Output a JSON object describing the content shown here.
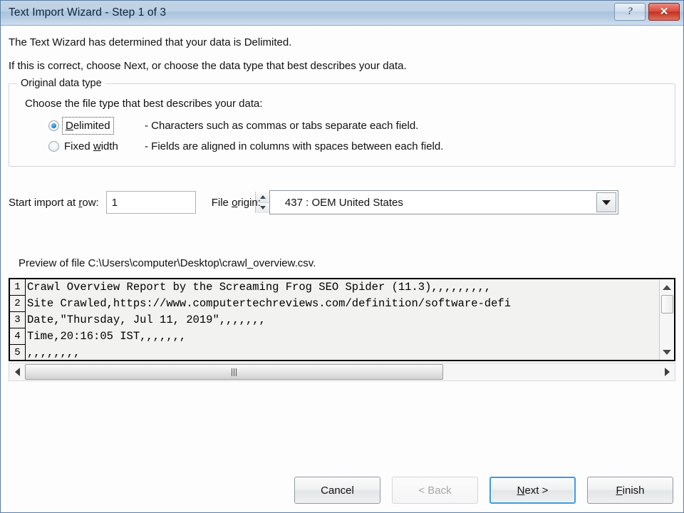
{
  "window": {
    "title": "Text Import Wizard - Step 1 of 3",
    "help_button": "?",
    "close_button": "✕"
  },
  "intro": {
    "line1": "The Text Wizard has determined that your data is Delimited.",
    "line2": "If this is correct, choose Next, or choose the data type that best describes your data."
  },
  "original_data_type": {
    "group_title": "Original data type",
    "lead": "Choose the file type that best describes your data:",
    "options": [
      {
        "label_prefix": "",
        "label_accel": "D",
        "label_suffix": "elimited",
        "description": "- Characters such as commas or tabs separate each field.",
        "selected": true,
        "focused": true
      },
      {
        "label_prefix": "Fixed ",
        "label_accel": "w",
        "label_suffix": "idth",
        "description": "- Fields are aligned in columns with spaces between each field.",
        "selected": false,
        "focused": false
      }
    ]
  },
  "options_row": {
    "start_row_label_prefix": "Start import at ",
    "start_row_label_accel": "r",
    "start_row_label_suffix": "ow:",
    "start_row_value": "1",
    "file_origin_label_prefix": "File ",
    "file_origin_label_accel": "o",
    "file_origin_label_suffix": "rigin:",
    "file_origin_value": "437 : OEM United States"
  },
  "preview": {
    "label": "Preview of file C:\\Users\\computer\\Desktop\\crawl_overview.csv.",
    "rows": [
      {
        "number": "1",
        "text": "Crawl Overview Report by the Screaming Frog SEO Spider (11.3),,,,,,,,,"
      },
      {
        "number": "2",
        "text": "Site Crawled,https://www.computertechreviews.com/definition/software-defi"
      },
      {
        "number": "3",
        "text": "Date,\"Thursday, Jul 11, 2019\",,,,,,,"
      },
      {
        "number": "4",
        "text": "Time,20:16:05 IST,,,,,,,"
      },
      {
        "number": "5",
        "text": ",,,,,,,,"
      }
    ]
  },
  "footer": {
    "cancel": "Cancel",
    "back": "< Back",
    "next_prefix": "",
    "next_accel": "N",
    "next_suffix": "ext >",
    "finish_prefix": "",
    "finish_accel": "F",
    "finish_suffix": "inish"
  },
  "colors": {
    "titlebar_accent": "#b6cbe3",
    "close_button": "#d94b3a",
    "radio_dot": "#1b83c8",
    "default_button_border": "#3c9ade"
  }
}
